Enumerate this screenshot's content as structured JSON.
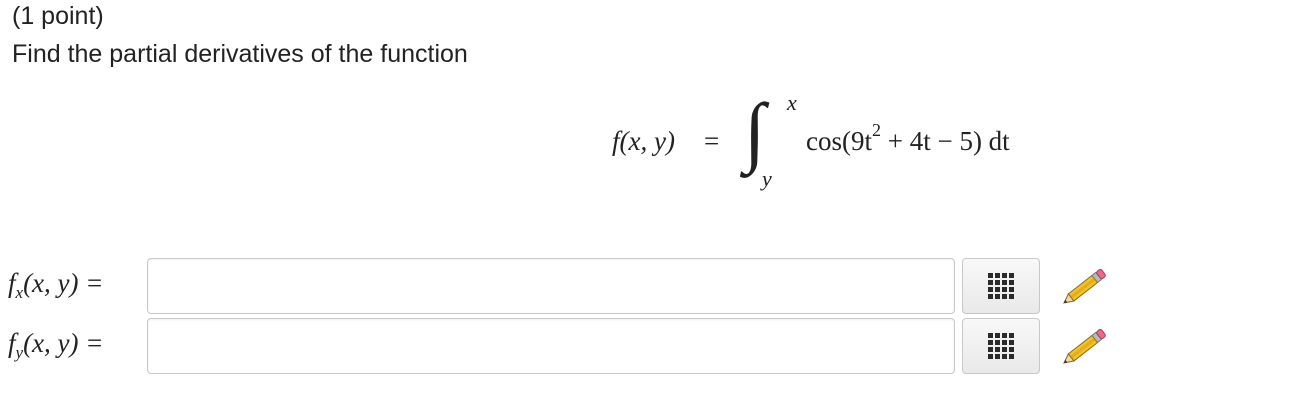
{
  "problem": {
    "points": "(1 point)",
    "instruction": "Find the partial derivatives of the function"
  },
  "formula": {
    "lhs": "f(x, y)",
    "equals": "=",
    "upper_limit": "x",
    "lower_limit": "y",
    "integrand_pre": "cos(9t",
    "exponent": "2",
    "integrand_post": " + 4t − 5) dt"
  },
  "answers": [
    {
      "func": "f",
      "subscript": "x",
      "args": "(x, y) =",
      "value": "",
      "palette_icon": "grid-icon",
      "edit_icon": "pencil-icon"
    },
    {
      "func": "f",
      "subscript": "y",
      "args": "(x, y) =",
      "value": "",
      "palette_icon": "grid-icon",
      "edit_icon": "pencil-icon"
    }
  ]
}
